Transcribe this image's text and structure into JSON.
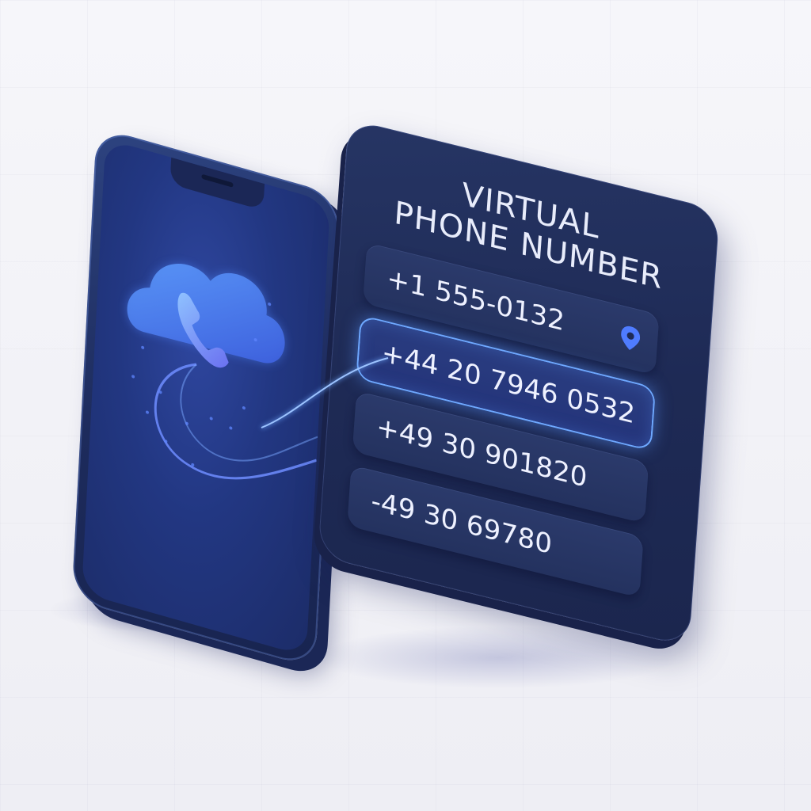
{
  "card": {
    "title_line1": "VIRTUAL",
    "title_line2": "PHONE NUMBER",
    "numbers": [
      {
        "value": "+1 555-0132",
        "icon": "location-pin-icon"
      },
      {
        "value": "+44 20 7946 0532",
        "highlighted": true
      },
      {
        "value": "+49 30 901820"
      },
      {
        "value": "-49 30 69780"
      }
    ]
  },
  "phone": {
    "screen_icon": "cloud-phone-icon"
  },
  "colors": {
    "background": "#f3f3f8",
    "navy": "#1e2a55",
    "accent_blue": "#4f7cff",
    "highlight": "#6ea8ff"
  }
}
